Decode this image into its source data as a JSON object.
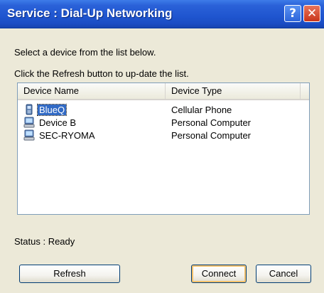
{
  "window": {
    "title": "Service : Dial-Up Networking",
    "help_glyph": "?",
    "close_glyph": "✕"
  },
  "instructions": {
    "line1": "Select a device from the list below.",
    "line2": "Click the Refresh button to up-date the list."
  },
  "device_list": {
    "columns": [
      "Device Name",
      "Device Type"
    ],
    "rows": [
      {
        "name": "BlueQ",
        "type": "Cellular Phone",
        "icon": "cellular-phone-icon",
        "selected": true
      },
      {
        "name": "Device B",
        "type": "Personal Computer",
        "icon": "computer-icon",
        "selected": false
      },
      {
        "name": "SEC-RYOMA",
        "type": "Personal Computer",
        "icon": "computer-icon",
        "selected": false
      }
    ]
  },
  "status": {
    "text": "Status : Ready"
  },
  "buttons": {
    "refresh": "Refresh",
    "connect": "Connect",
    "cancel": "Cancel"
  },
  "colors": {
    "titlebar": "#2a61d8",
    "dialog_bg": "#ece9d8",
    "selection": "#316ac5"
  }
}
